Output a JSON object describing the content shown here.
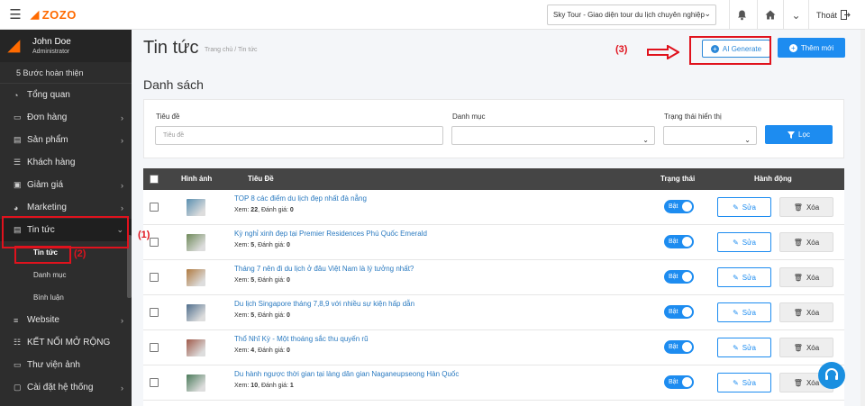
{
  "topbar": {
    "brand": "ZOZO",
    "site_selector": "Sky Tour - Giao diện tour du lịch chuyên nghiệp",
    "logout_label": "Thoát"
  },
  "sidebar": {
    "user_name": "John Doe",
    "user_role": "Administrator",
    "steps_label": "5 Bước hoàn thiện",
    "items": [
      {
        "label": "Tổng quan",
        "icon": "dashboard-icon",
        "has_arrow": false
      },
      {
        "label": "Đơn hàng",
        "icon": "order-icon",
        "has_arrow": true
      },
      {
        "label": "Sản phẩm",
        "icon": "product-icon",
        "has_arrow": true
      },
      {
        "label": "Khách hàng",
        "icon": "customers-icon",
        "has_arrow": false
      },
      {
        "label": "Giảm giá",
        "icon": "discount-icon",
        "has_arrow": true
      },
      {
        "label": "Marketing",
        "icon": "marketing-icon",
        "has_arrow": true
      },
      {
        "label": "Tin tức",
        "icon": "news-icon",
        "has_arrow": true,
        "expanded": true
      },
      {
        "label": "Website",
        "icon": "website-icon",
        "has_arrow": true
      },
      {
        "label": "KẾT NỐI MỞ RỘNG",
        "icon": "plugin-icon",
        "has_arrow": false
      },
      {
        "label": "Thư viện ảnh",
        "icon": "gallery-icon",
        "has_arrow": false
      },
      {
        "label": "Cài đặt hệ thống",
        "icon": "settings-icon",
        "has_arrow": true
      }
    ],
    "sub_items": [
      "Tin tức",
      "Danh mục",
      "Bình luận"
    ]
  },
  "annotations": {
    "one": "(1)",
    "two": "(2)",
    "three": "(3)"
  },
  "page": {
    "title": "Tin tức",
    "breadcrumb": "Trang chủ  /  Tin tức",
    "ai_button": "AI Generate",
    "add_button": "Thêm mới",
    "section_title": "Danh sách"
  },
  "filter": {
    "title_label": "Tiêu đề",
    "title_placeholder": "Tiêu đề",
    "category_label": "Danh mục",
    "status_label": "Trạng thái hiển thị",
    "filter_button": "Lọc"
  },
  "table": {
    "columns": [
      "Hình ảnh",
      "Tiêu Đề",
      "Trạng thái",
      "Hành động"
    ],
    "toggle_label": "Bật",
    "edit_label": "Sửa",
    "delete_label": "Xóa",
    "views_label": "Xem:",
    "rating_label": "Đánh giá:",
    "rows": [
      {
        "title": "TOP 8 các điểm du lịch đẹp nhất đà nẵng",
        "views": "22",
        "rating": "0",
        "thumb": "#5a8fb0"
      },
      {
        "title": "Kỳ nghỉ xinh đẹp tại Premier Residences Phú Quốc Emerald",
        "views": "5",
        "rating": "0",
        "thumb": "#6f8a5a"
      },
      {
        "title": "Tháng 7 nên đi du lịch ở đâu Việt Nam là lý tưởng nhất?",
        "views": "5",
        "rating": "0",
        "thumb": "#b07a40"
      },
      {
        "title": "Du lịch Singapore tháng 7,8,9 với nhiều sự kiện hấp dẫn",
        "views": "5",
        "rating": "0",
        "thumb": "#4f6e8c"
      },
      {
        "title": "Thổ Nhĩ Kỳ - Một thoáng sắc thu quyến rũ",
        "views": "4",
        "rating": "0",
        "thumb": "#a05a4a"
      },
      {
        "title": "Du hành ngược thời gian tại làng dân gian Naganeupseong Hàn Quốc",
        "views": "10",
        "rating": "1",
        "thumb": "#4a7a5a"
      }
    ]
  }
}
